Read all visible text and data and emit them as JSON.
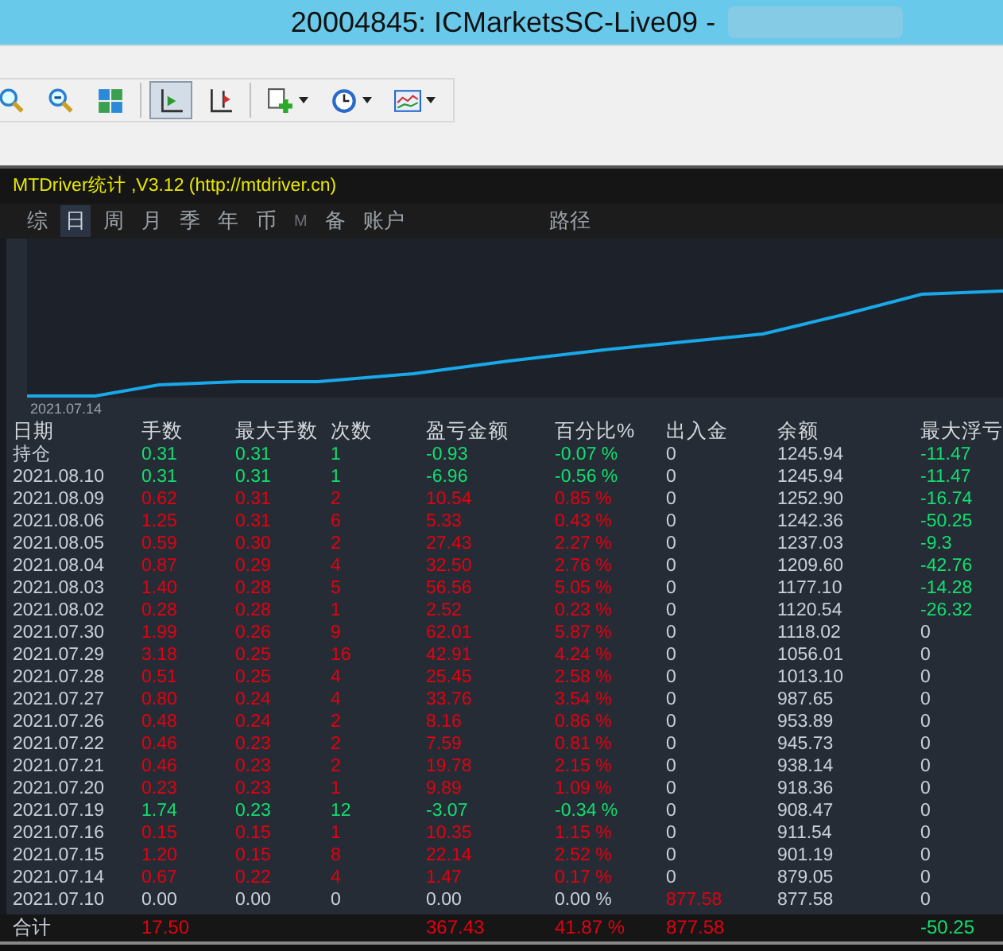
{
  "window": {
    "title": "20004845: ICMarketsSC-Live09 -"
  },
  "toolbar": {
    "items": [
      {
        "kind": "zoom-in",
        "pressed": false
      },
      {
        "kind": "zoom-out",
        "pressed": false
      },
      {
        "kind": "tile",
        "pressed": false
      },
      {
        "kind": "sep"
      },
      {
        "kind": "autoscroll",
        "pressed": true
      },
      {
        "kind": "shift",
        "pressed": false
      },
      {
        "kind": "sep"
      },
      {
        "kind": "new-chart",
        "pressed": false
      },
      {
        "kind": "clock",
        "pressed": false
      },
      {
        "kind": "template",
        "pressed": false
      }
    ]
  },
  "panel": {
    "caption": "MTDriver统计 ,V3.12 (http://mtdriver.cn)",
    "tabs": [
      {
        "label": "综",
        "selected": false,
        "disabled": false
      },
      {
        "label": "日",
        "selected": true,
        "disabled": false
      },
      {
        "label": "周",
        "selected": false,
        "disabled": false
      },
      {
        "label": "月",
        "selected": false,
        "disabled": false
      },
      {
        "label": "季",
        "selected": false,
        "disabled": false
      },
      {
        "label": "年",
        "selected": false,
        "disabled": false
      },
      {
        "label": "币",
        "selected": false,
        "disabled": false
      },
      {
        "label": "M",
        "selected": false,
        "disabled": true
      },
      {
        "label": "备",
        "selected": false,
        "disabled": false
      },
      {
        "label": "账户",
        "selected": false,
        "disabled": false
      },
      {
        "label": "路径",
        "selected": false,
        "disabled": false
      }
    ],
    "chart_start_label": "2021.07.14"
  },
  "table": {
    "columns": [
      "日期",
      "手数",
      "最大手数",
      "次数",
      "盈亏金额",
      "百分比%",
      "出入金",
      "余额",
      "最大浮亏"
    ],
    "rows": [
      {
        "cells": [
          {
            "text": "持仓",
            "color": "#c8d0dc"
          },
          {
            "text": "0.31",
            "color": "#10e070"
          },
          {
            "text": "0.31",
            "color": "#10e070"
          },
          {
            "text": "1",
            "color": "#10e070"
          },
          {
            "text": "-0.93",
            "color": "#10e070"
          },
          {
            "text": "-0.07 %",
            "color": "#10e070"
          },
          {
            "text": "0",
            "color": "#c8d0dc"
          },
          {
            "text": "1245.94",
            "color": "#c8d0dc"
          },
          {
            "text": "-11.47",
            "color": "#10e070"
          }
        ]
      },
      {
        "cells": [
          {
            "text": "2021.08.10",
            "color": "#c8d0dc"
          },
          {
            "text": "0.31",
            "color": "#10e070"
          },
          {
            "text": "0.31",
            "color": "#10e070"
          },
          {
            "text": "1",
            "color": "#10e070"
          },
          {
            "text": "-6.96",
            "color": "#10e070"
          },
          {
            "text": "-0.56 %",
            "color": "#10e070"
          },
          {
            "text": "0",
            "color": "#c8d0dc"
          },
          {
            "text": "1245.94",
            "color": "#c8d0dc"
          },
          {
            "text": "-11.47",
            "color": "#10e070"
          }
        ]
      },
      {
        "cells": [
          {
            "text": "2021.08.09",
            "color": "#c8d0dc"
          },
          {
            "text": "0.62",
            "color": "#e40010"
          },
          {
            "text": "0.31",
            "color": "#e40010"
          },
          {
            "text": "2",
            "color": "#e40010"
          },
          {
            "text": "10.54",
            "color": "#e40010"
          },
          {
            "text": "0.85 %",
            "color": "#e40010"
          },
          {
            "text": "0",
            "color": "#c8d0dc"
          },
          {
            "text": "1252.90",
            "color": "#c8d0dc"
          },
          {
            "text": "-16.74",
            "color": "#10e070"
          }
        ]
      },
      {
        "cells": [
          {
            "text": "2021.08.06",
            "color": "#c8d0dc"
          },
          {
            "text": "1.25",
            "color": "#e40010"
          },
          {
            "text": "0.31",
            "color": "#e40010"
          },
          {
            "text": "6",
            "color": "#e40010"
          },
          {
            "text": "5.33",
            "color": "#e40010"
          },
          {
            "text": "0.43 %",
            "color": "#e40010"
          },
          {
            "text": "0",
            "color": "#c8d0dc"
          },
          {
            "text": "1242.36",
            "color": "#c8d0dc"
          },
          {
            "text": "-50.25",
            "color": "#10e070"
          }
        ]
      },
      {
        "cells": [
          {
            "text": "2021.08.05",
            "color": "#c8d0dc"
          },
          {
            "text": "0.59",
            "color": "#e40010"
          },
          {
            "text": "0.30",
            "color": "#e40010"
          },
          {
            "text": "2",
            "color": "#e40010"
          },
          {
            "text": "27.43",
            "color": "#e40010"
          },
          {
            "text": "2.27 %",
            "color": "#e40010"
          },
          {
            "text": "0",
            "color": "#c8d0dc"
          },
          {
            "text": "1237.03",
            "color": "#c8d0dc"
          },
          {
            "text": "-9.3",
            "color": "#10e070"
          }
        ]
      },
      {
        "cells": [
          {
            "text": "2021.08.04",
            "color": "#c8d0dc"
          },
          {
            "text": "0.87",
            "color": "#e40010"
          },
          {
            "text": "0.29",
            "color": "#e40010"
          },
          {
            "text": "4",
            "color": "#e40010"
          },
          {
            "text": "32.50",
            "color": "#e40010"
          },
          {
            "text": "2.76 %",
            "color": "#e40010"
          },
          {
            "text": "0",
            "color": "#c8d0dc"
          },
          {
            "text": "1209.60",
            "color": "#c8d0dc"
          },
          {
            "text": "-42.76",
            "color": "#10e070"
          }
        ]
      },
      {
        "cells": [
          {
            "text": "2021.08.03",
            "color": "#c8d0dc"
          },
          {
            "text": "1.40",
            "color": "#e40010"
          },
          {
            "text": "0.28",
            "color": "#e40010"
          },
          {
            "text": "5",
            "color": "#e40010"
          },
          {
            "text": "56.56",
            "color": "#e40010"
          },
          {
            "text": "5.05 %",
            "color": "#e40010"
          },
          {
            "text": "0",
            "color": "#c8d0dc"
          },
          {
            "text": "1177.10",
            "color": "#c8d0dc"
          },
          {
            "text": "-14.28",
            "color": "#10e070"
          }
        ]
      },
      {
        "cells": [
          {
            "text": "2021.08.02",
            "color": "#c8d0dc"
          },
          {
            "text": "0.28",
            "color": "#e40010"
          },
          {
            "text": "0.28",
            "color": "#e40010"
          },
          {
            "text": "1",
            "color": "#e40010"
          },
          {
            "text": "2.52",
            "color": "#e40010"
          },
          {
            "text": "0.23 %",
            "color": "#e40010"
          },
          {
            "text": "0",
            "color": "#c8d0dc"
          },
          {
            "text": "1120.54",
            "color": "#c8d0dc"
          },
          {
            "text": "-26.32",
            "color": "#10e070"
          }
        ]
      },
      {
        "cells": [
          {
            "text": "2021.07.30",
            "color": "#c8d0dc"
          },
          {
            "text": "1.99",
            "color": "#e40010"
          },
          {
            "text": "0.26",
            "color": "#e40010"
          },
          {
            "text": "9",
            "color": "#e40010"
          },
          {
            "text": "62.01",
            "color": "#e40010"
          },
          {
            "text": "5.87 %",
            "color": "#e40010"
          },
          {
            "text": "0",
            "color": "#c8d0dc"
          },
          {
            "text": "1118.02",
            "color": "#c8d0dc"
          },
          {
            "text": "0",
            "color": "#c8d0dc"
          }
        ]
      },
      {
        "cells": [
          {
            "text": "2021.07.29",
            "color": "#c8d0dc"
          },
          {
            "text": "3.18",
            "color": "#e40010"
          },
          {
            "text": "0.25",
            "color": "#e40010"
          },
          {
            "text": "16",
            "color": "#e40010"
          },
          {
            "text": "42.91",
            "color": "#e40010"
          },
          {
            "text": "4.24 %",
            "color": "#e40010"
          },
          {
            "text": "0",
            "color": "#c8d0dc"
          },
          {
            "text": "1056.01",
            "color": "#c8d0dc"
          },
          {
            "text": "0",
            "color": "#c8d0dc"
          }
        ]
      },
      {
        "cells": [
          {
            "text": "2021.07.28",
            "color": "#c8d0dc"
          },
          {
            "text": "0.51",
            "color": "#e40010"
          },
          {
            "text": "0.25",
            "color": "#e40010"
          },
          {
            "text": "4",
            "color": "#e40010"
          },
          {
            "text": "25.45",
            "color": "#e40010"
          },
          {
            "text": "2.58 %",
            "color": "#e40010"
          },
          {
            "text": "0",
            "color": "#c8d0dc"
          },
          {
            "text": "1013.10",
            "color": "#c8d0dc"
          },
          {
            "text": "0",
            "color": "#c8d0dc"
          }
        ]
      },
      {
        "cells": [
          {
            "text": "2021.07.27",
            "color": "#c8d0dc"
          },
          {
            "text": "0.80",
            "color": "#e40010"
          },
          {
            "text": "0.24",
            "color": "#e40010"
          },
          {
            "text": "4",
            "color": "#e40010"
          },
          {
            "text": "33.76",
            "color": "#e40010"
          },
          {
            "text": "3.54 %",
            "color": "#e40010"
          },
          {
            "text": "0",
            "color": "#c8d0dc"
          },
          {
            "text": "987.65",
            "color": "#c8d0dc"
          },
          {
            "text": "0",
            "color": "#c8d0dc"
          }
        ]
      },
      {
        "cells": [
          {
            "text": "2021.07.26",
            "color": "#c8d0dc"
          },
          {
            "text": "0.48",
            "color": "#e40010"
          },
          {
            "text": "0.24",
            "color": "#e40010"
          },
          {
            "text": "2",
            "color": "#e40010"
          },
          {
            "text": "8.16",
            "color": "#e40010"
          },
          {
            "text": "0.86 %",
            "color": "#e40010"
          },
          {
            "text": "0",
            "color": "#c8d0dc"
          },
          {
            "text": "953.89",
            "color": "#c8d0dc"
          },
          {
            "text": "0",
            "color": "#c8d0dc"
          }
        ]
      },
      {
        "cells": [
          {
            "text": "2021.07.22",
            "color": "#c8d0dc"
          },
          {
            "text": "0.46",
            "color": "#e40010"
          },
          {
            "text": "0.23",
            "color": "#e40010"
          },
          {
            "text": "2",
            "color": "#e40010"
          },
          {
            "text": "7.59",
            "color": "#e40010"
          },
          {
            "text": "0.81 %",
            "color": "#e40010"
          },
          {
            "text": "0",
            "color": "#c8d0dc"
          },
          {
            "text": "945.73",
            "color": "#c8d0dc"
          },
          {
            "text": "0",
            "color": "#c8d0dc"
          }
        ]
      },
      {
        "cells": [
          {
            "text": "2021.07.21",
            "color": "#c8d0dc"
          },
          {
            "text": "0.46",
            "color": "#e40010"
          },
          {
            "text": "0.23",
            "color": "#e40010"
          },
          {
            "text": "2",
            "color": "#e40010"
          },
          {
            "text": "19.78",
            "color": "#e40010"
          },
          {
            "text": "2.15 %",
            "color": "#e40010"
          },
          {
            "text": "0",
            "color": "#c8d0dc"
          },
          {
            "text": "938.14",
            "color": "#c8d0dc"
          },
          {
            "text": "0",
            "color": "#c8d0dc"
          }
        ]
      },
      {
        "cells": [
          {
            "text": "2021.07.20",
            "color": "#c8d0dc"
          },
          {
            "text": "0.23",
            "color": "#e40010"
          },
          {
            "text": "0.23",
            "color": "#e40010"
          },
          {
            "text": "1",
            "color": "#e40010"
          },
          {
            "text": "9.89",
            "color": "#e40010"
          },
          {
            "text": "1.09 %",
            "color": "#e40010"
          },
          {
            "text": "0",
            "color": "#c8d0dc"
          },
          {
            "text": "918.36",
            "color": "#c8d0dc"
          },
          {
            "text": "0",
            "color": "#c8d0dc"
          }
        ]
      },
      {
        "cells": [
          {
            "text": "2021.07.19",
            "color": "#c8d0dc"
          },
          {
            "text": "1.74",
            "color": "#10e070"
          },
          {
            "text": "0.23",
            "color": "#10e070"
          },
          {
            "text": "12",
            "color": "#10e070"
          },
          {
            "text": "-3.07",
            "color": "#10e070"
          },
          {
            "text": "-0.34 %",
            "color": "#10e070"
          },
          {
            "text": "0",
            "color": "#c8d0dc"
          },
          {
            "text": "908.47",
            "color": "#c8d0dc"
          },
          {
            "text": "0",
            "color": "#c8d0dc"
          }
        ]
      },
      {
        "cells": [
          {
            "text": "2021.07.16",
            "color": "#c8d0dc"
          },
          {
            "text": "0.15",
            "color": "#e40010"
          },
          {
            "text": "0.15",
            "color": "#e40010"
          },
          {
            "text": "1",
            "color": "#e40010"
          },
          {
            "text": "10.35",
            "color": "#e40010"
          },
          {
            "text": "1.15 %",
            "color": "#e40010"
          },
          {
            "text": "0",
            "color": "#c8d0dc"
          },
          {
            "text": "911.54",
            "color": "#c8d0dc"
          },
          {
            "text": "0",
            "color": "#c8d0dc"
          }
        ]
      },
      {
        "cells": [
          {
            "text": "2021.07.15",
            "color": "#c8d0dc"
          },
          {
            "text": "1.20",
            "color": "#e40010"
          },
          {
            "text": "0.15",
            "color": "#e40010"
          },
          {
            "text": "8",
            "color": "#e40010"
          },
          {
            "text": "22.14",
            "color": "#e40010"
          },
          {
            "text": "2.52 %",
            "color": "#e40010"
          },
          {
            "text": "0",
            "color": "#c8d0dc"
          },
          {
            "text": "901.19",
            "color": "#c8d0dc"
          },
          {
            "text": "0",
            "color": "#c8d0dc"
          }
        ]
      },
      {
        "cells": [
          {
            "text": "2021.07.14",
            "color": "#c8d0dc"
          },
          {
            "text": "0.67",
            "color": "#e40010"
          },
          {
            "text": "0.22",
            "color": "#e40010"
          },
          {
            "text": "4",
            "color": "#e40010"
          },
          {
            "text": "1.47",
            "color": "#e40010"
          },
          {
            "text": "0.17 %",
            "color": "#e40010"
          },
          {
            "text": "0",
            "color": "#c8d0dc"
          },
          {
            "text": "879.05",
            "color": "#c8d0dc"
          },
          {
            "text": "0",
            "color": "#c8d0dc"
          }
        ]
      },
      {
        "cells": [
          {
            "text": "2021.07.10",
            "color": "#c8d0dc"
          },
          {
            "text": "0.00",
            "color": "#c8d0dc"
          },
          {
            "text": "0.00",
            "color": "#c8d0dc"
          },
          {
            "text": "0",
            "color": "#c8d0dc"
          },
          {
            "text": "0.00",
            "color": "#c8d0dc"
          },
          {
            "text": "0.00 %",
            "color": "#c8d0dc"
          },
          {
            "text": "877.58",
            "color": "#e40010"
          },
          {
            "text": "877.58",
            "color": "#c8d0dc"
          },
          {
            "text": "0",
            "color": "#c8d0dc"
          }
        ]
      }
    ],
    "total": {
      "label": {
        "text": "合计",
        "color": "#c8d0dc"
      },
      "lots": {
        "text": "17.50",
        "color": "#e40010"
      },
      "profit": {
        "text": "367.43",
        "color": "#e40010"
      },
      "percent": {
        "text": "41.87 %",
        "color": "#e40010"
      },
      "deposit": {
        "text": "877.58",
        "color": "#e40010"
      },
      "max_float": {
        "text": "-50.25",
        "color": "#10e070"
      }
    }
  }
}
